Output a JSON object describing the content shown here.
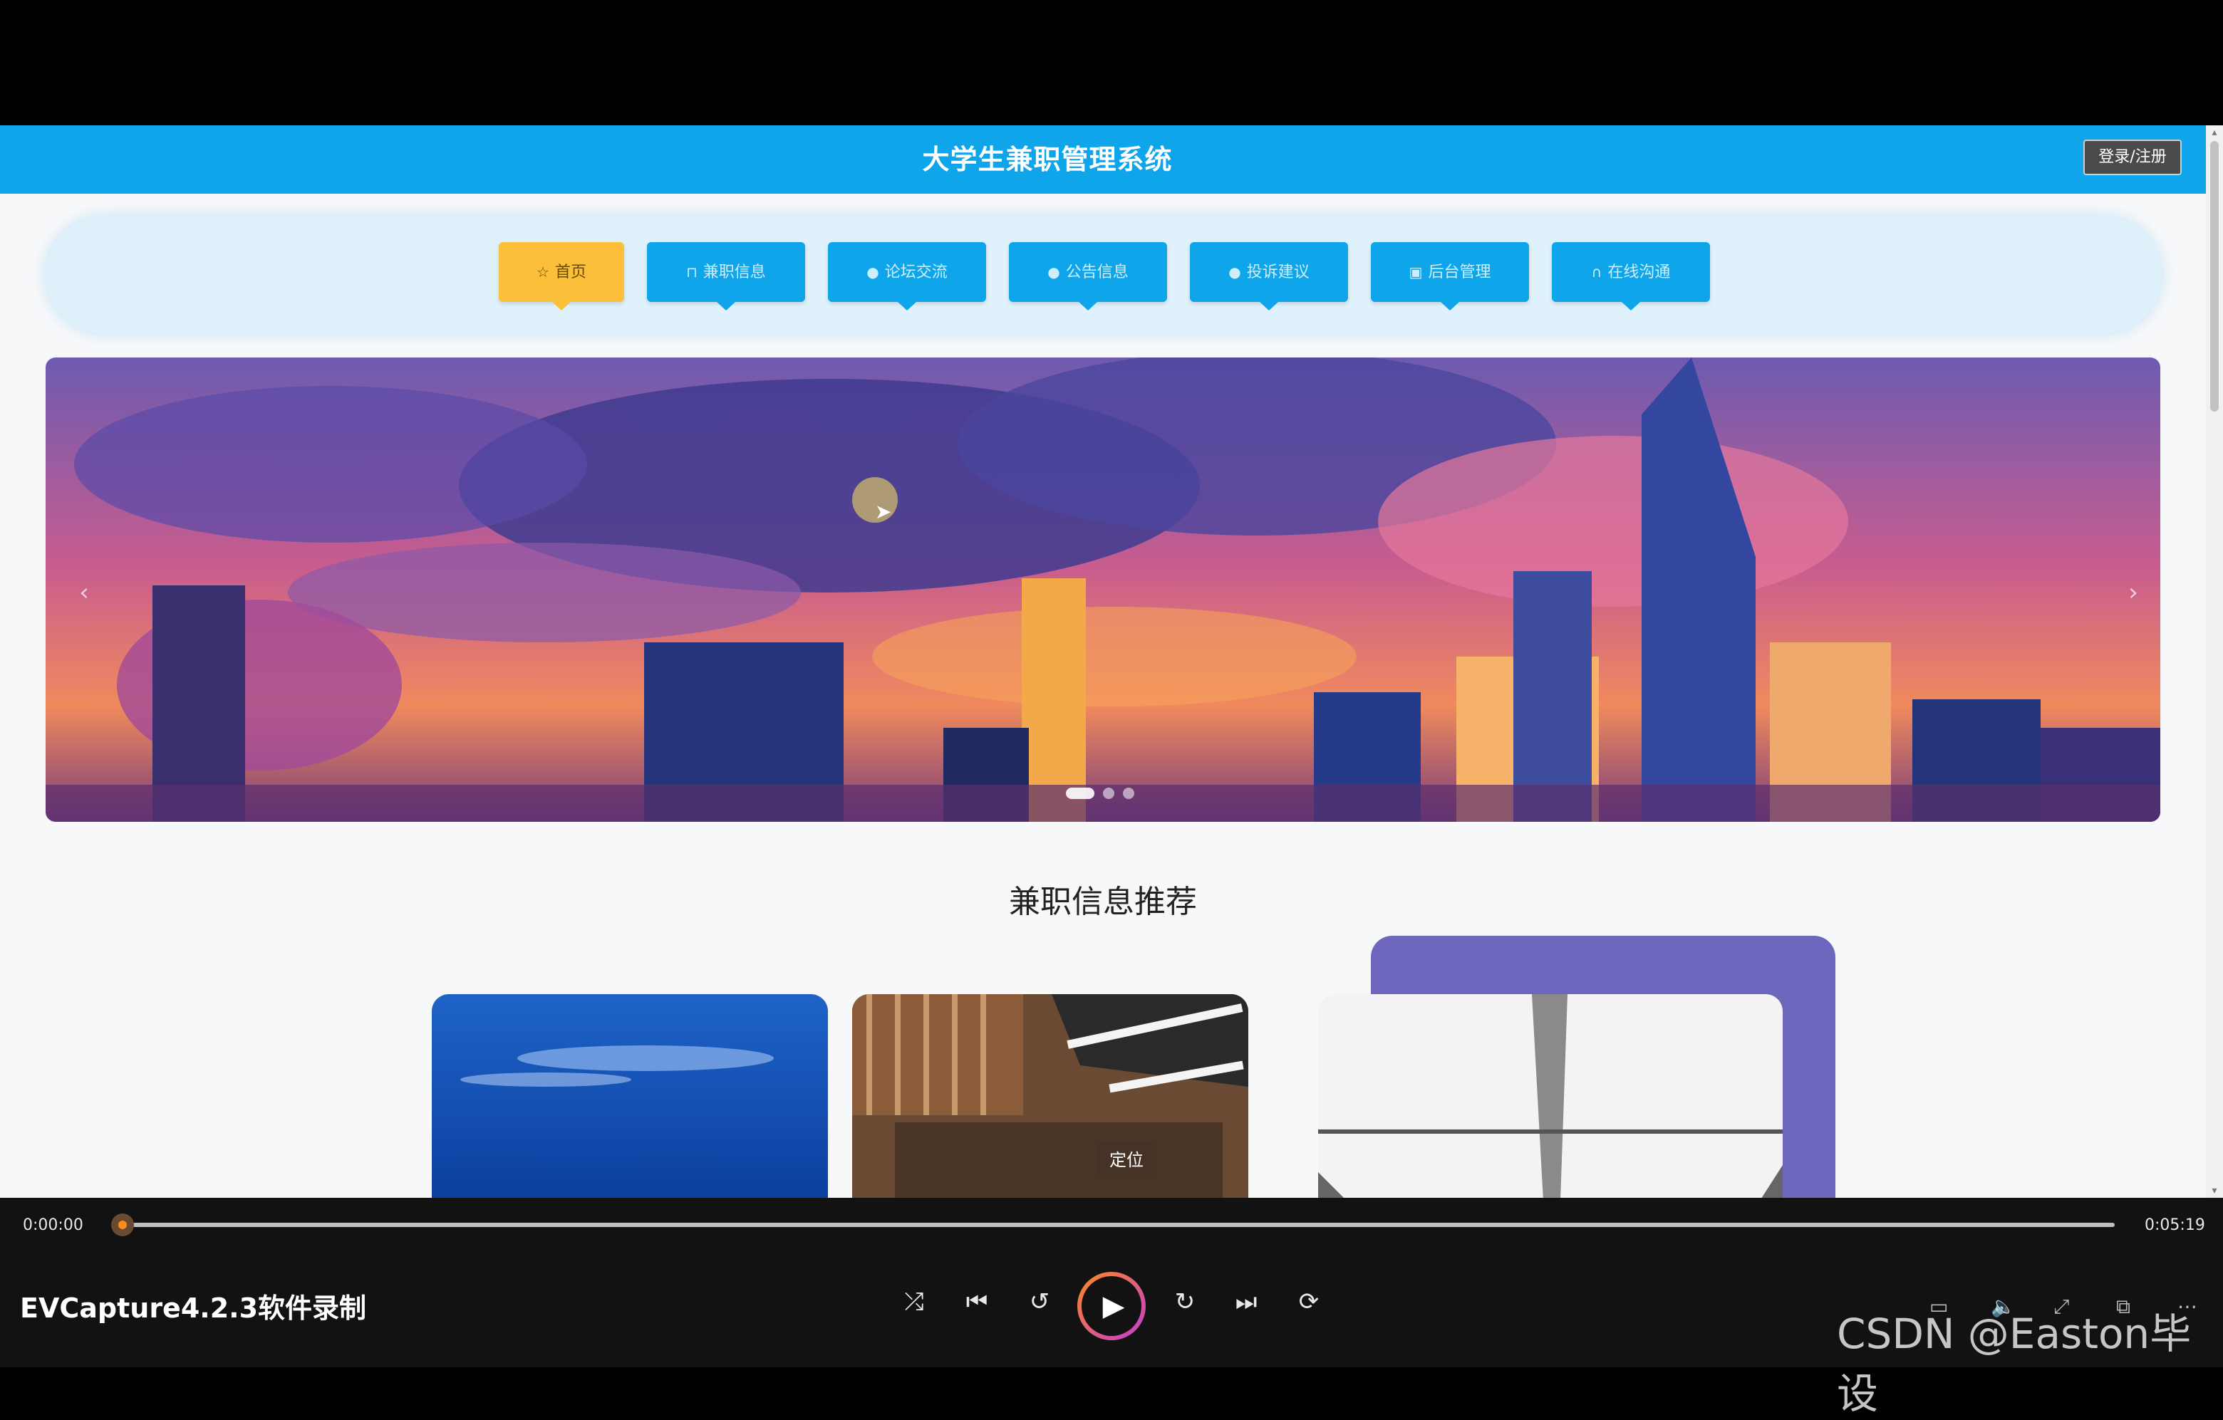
{
  "header": {
    "site_title": "大学生兼职管理系统",
    "login_label": "登录/注册"
  },
  "nav": {
    "items": [
      {
        "label": "首页",
        "icon": "star-icon",
        "active": true
      },
      {
        "label": "兼职信息",
        "icon": "briefcase-icon",
        "active": false
      },
      {
        "label": "论坛交流",
        "icon": "info-icon",
        "active": false
      },
      {
        "label": "公告信息",
        "icon": "question-icon",
        "active": false
      },
      {
        "label": "投诉建议",
        "icon": "info-icon",
        "active": false
      },
      {
        "label": "后台管理",
        "icon": "admin-icon",
        "active": false
      },
      {
        "label": "在线沟通",
        "icon": "headset-icon",
        "active": false
      }
    ]
  },
  "banner": {
    "prev_icon": "‹",
    "next_icon": "›"
  },
  "section": {
    "title": "兼职信息推荐"
  },
  "cards": {
    "tooltip": "定位"
  },
  "player": {
    "current_time": "0:00:00",
    "total_time": "0:05:19",
    "progress": 0.0,
    "app_label": "EVCapture4.2.3软件录制",
    "watermark": "CSDN @Easton毕设",
    "controls": [
      "shuffle-icon",
      "previous-icon",
      "rewind-10-icon",
      "play-icon",
      "forward-30-icon",
      "next-icon",
      "repeat-icon"
    ],
    "colors": {
      "accent": "#ff8a1c",
      "accent2": "#c23bd4"
    }
  },
  "colors": {
    "header": "#0ea5ea",
    "nav_active": "#fbbf3a",
    "nav_panel": "#dff2fc"
  }
}
